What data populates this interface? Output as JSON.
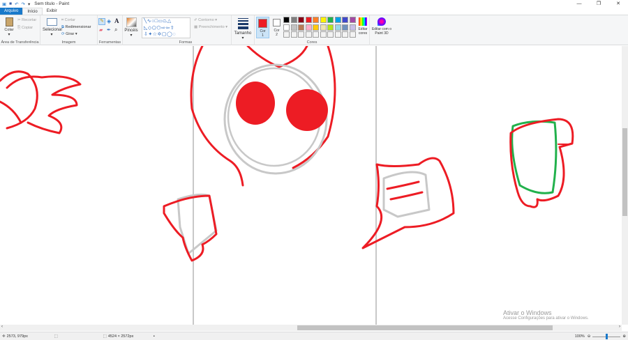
{
  "window": {
    "title": "Sem título - Paint",
    "minimize": "—",
    "maximize": "❐",
    "close": "✕"
  },
  "tabs": [
    {
      "label": "Arquivo"
    },
    {
      "label": "Início"
    },
    {
      "label": "Exibir"
    }
  ],
  "ribbon": {
    "clipboard": {
      "paste": "Colar",
      "cut": "Recortar",
      "copy": "Copiar",
      "label": "Área de Transferência"
    },
    "image": {
      "select": "Selecionar",
      "crop": "Cortar",
      "resize": "Redimensionar",
      "rotate": "Girar",
      "label": "Imagem"
    },
    "tools": {
      "label": "Ferramentas"
    },
    "brushes": {
      "label": "Pincéis"
    },
    "shapes": {
      "outline": "Contorno",
      "fill": "Preenchimento",
      "label": "Formas"
    },
    "size": {
      "label": "Tamanho"
    },
    "colors": {
      "color1": "Cor 1",
      "color2": "Cor 2",
      "edit": "Editar cores",
      "paint3d": "Editar com o Paint 3D",
      "label": "Cores",
      "color1_value": "#ed1c24",
      "color2_value": "#ffffff",
      "palette_row1": [
        "#000000",
        "#7f7f7f",
        "#880015",
        "#ed1c24",
        "#ff7f27",
        "#fff200",
        "#22b14c",
        "#00a2e8",
        "#3f48cc",
        "#a349a4"
      ],
      "palette_row2": [
        "#ffffff",
        "#c3c3c3",
        "#b97a57",
        "#ffaec9",
        "#ffc90e",
        "#efe4b0",
        "#b5e61d",
        "#99d9ea",
        "#7092be",
        "#c8bfe7"
      ]
    }
  },
  "status": {
    "cursor_pos": "2573, 979px",
    "image_size": "4524 × 2572px",
    "zoom": "100%",
    "zoom_fraction": 0.5
  },
  "watermark": {
    "title": "Ativar o Windows",
    "subtitle": "Acesse Configurações para ativar o Windows."
  }
}
